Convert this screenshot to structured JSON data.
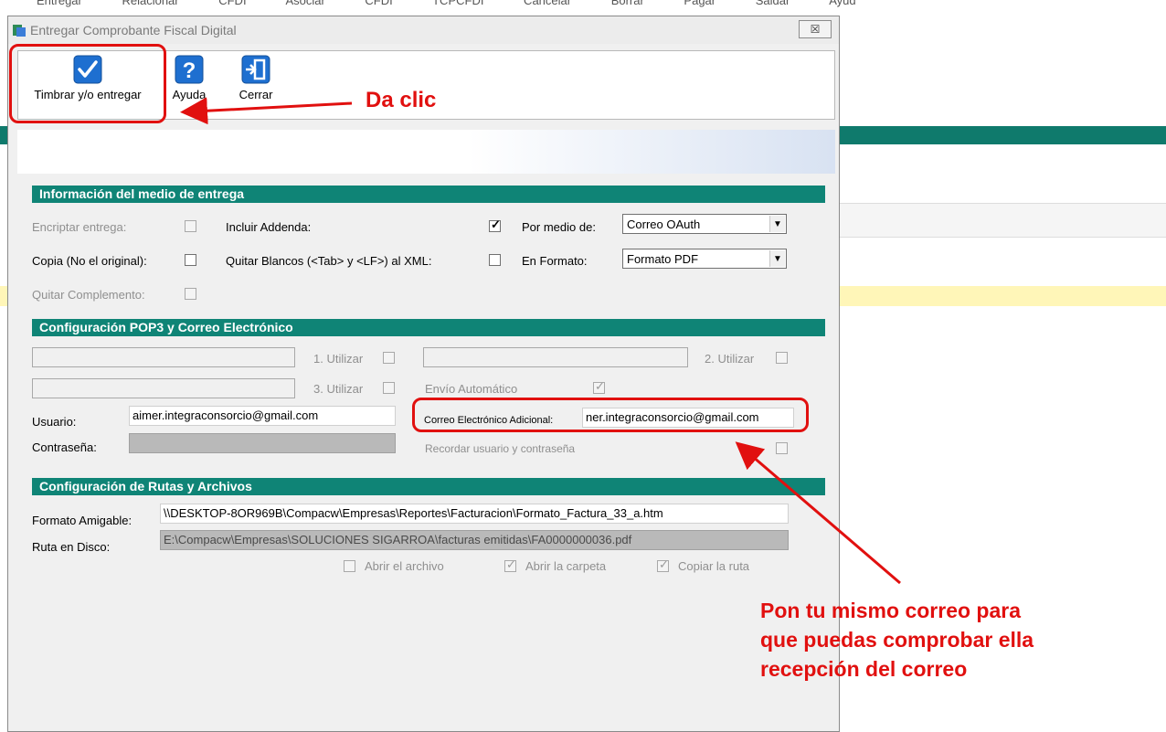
{
  "background": {
    "top_menu": [
      "Entregar",
      "Relacionar CFDI",
      "Asociar CFDI",
      "TCPCFDI",
      "Cancelar",
      "Borrar",
      "Pagar",
      "Saldar",
      "Ayud"
    ]
  },
  "window": {
    "title": "Entregar Comprobante Fiscal Digital",
    "close_label": "☒"
  },
  "toolbar": {
    "stamp_label": "Timbrar y/o entregar",
    "help_label": "Ayuda",
    "close_label": "Cerrar"
  },
  "delivery_section": {
    "title": "Información del medio de entrega",
    "encrypt_label": "Encriptar entrega:",
    "copy_label": "Copia (No el original):",
    "remove_complement_label": "Quitar Complemento:",
    "include_addenda_label": "Incluir Addenda:",
    "remove_blanks_label": "Quitar Blancos (<Tab> y <LF>) al  XML:",
    "via_label": "Por medio de:",
    "via_value": "Correo OAuth",
    "format_label": "En Formato:",
    "format_value": "Formato PDF",
    "include_addenda_checked": true
  },
  "pop3_section": {
    "title": "Configuración POP3 y Correo Electrónico",
    "use1_label": "1. Utilizar",
    "use2_label": "2. Utilizar",
    "use3_label": "3. Utilizar",
    "auto_send_label": "Envío Automático",
    "user_label": "Usuario:",
    "user_value": "aimer.integraconsorcio@gmail.com",
    "password_label": "Contraseña:",
    "additional_email_label": "Correo Electrónico Adicional:",
    "additional_email_value": "ner.integraconsorcio@gmail.com",
    "remember_label": "Recordar usuario y contraseña"
  },
  "paths_section": {
    "title": "Configuración de Rutas y Archivos",
    "friendly_format_label": "Formato Amigable:",
    "friendly_format_value": "\\\\DESKTOP-8OR969B\\Compacw\\Empresas\\Reportes\\Facturacion\\Formato_Factura_33_a.htm",
    "disk_path_label": "Ruta en Disco:",
    "disk_path_value": "E:\\Compacw\\Empresas\\SOLUCIONES SIGARROA\\facturas emitidas\\FA0000000036.pdf",
    "open_file_label": "Abrir el archivo",
    "open_folder_label": "Abrir la carpeta",
    "copy_path_label": "Copiar la ruta"
  },
  "annotations": {
    "click_text": "Da clic",
    "note_line1": "Pon tu mismo correo para",
    "note_line2": "que puedas comprobar ella",
    "note_line3": "recepción del correo",
    "color": "#e1100f"
  },
  "colors": {
    "section_header": "#0f8476",
    "annotation_red": "#e1100f"
  }
}
